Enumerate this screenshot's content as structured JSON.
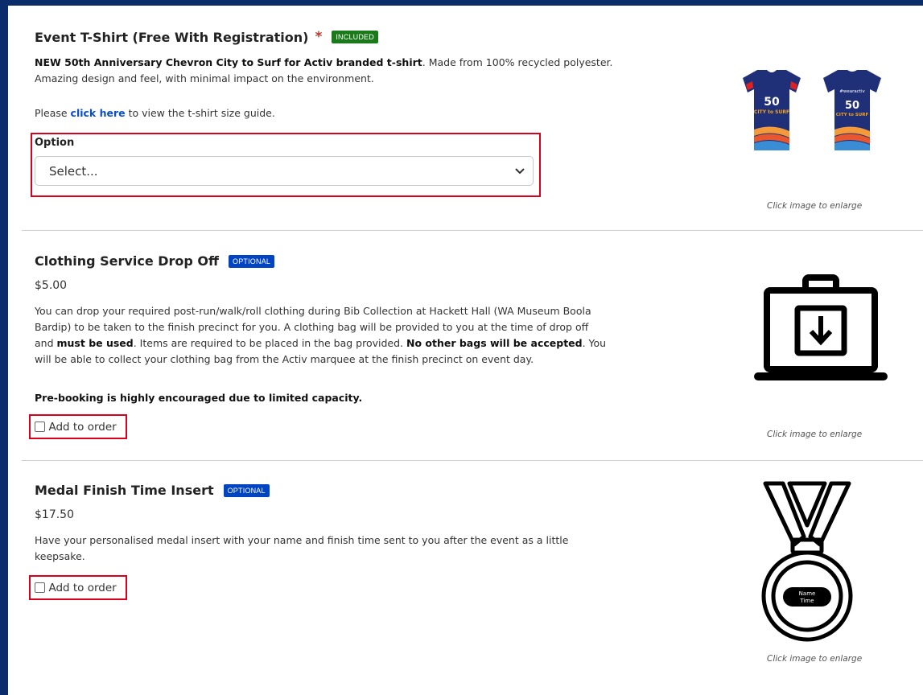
{
  "tshirt": {
    "title": "Event T-Shirt (Free With Registration)",
    "required_mark": "*",
    "badge": "INCLUDED",
    "desc_bold": "NEW 50th Anniversary Chevron City to Surf for Activ branded t-shirt",
    "desc_rest_1": ". Made from 100% recycled polyester.",
    "desc_line2": "Amazing design and feel, with minimal impact on the environment.",
    "guide_prefix": "Please ",
    "guide_link": "click here",
    "guide_suffix": " to view the t-shirt size guide.",
    "option_label": "Option",
    "select_value": "Select...",
    "caption": "Click image to enlarge",
    "shirt_text_front": "50",
    "shirt_text_back": "50",
    "shirt_hashtag": "#wearactiv",
    "shirt_city": "CITY to SURF"
  },
  "clothing": {
    "title": "Clothing Service Drop Off",
    "badge": "OPTIONAL",
    "price": "$5.00",
    "line1": "You can drop your required post-run/walk/roll clothing during Bib Collection at Hackett Hall (WA Museum Boola",
    "line2": "Bardip) to be taken to the finish precinct for you. A clothing bag will be provided to you at the time of drop off",
    "line3a": "and ",
    "line3b": "must be used",
    "line3c": ". Items are required to be placed in the bag provided. ",
    "line3d": "No other bags will be accepted",
    "line3e": ". You",
    "line4": "will be able to collect your clothing bag from the Activ marquee at the finish precinct on event day.",
    "note": "Pre-booking is highly encouraged due to limited capacity.",
    "add_label": "Add to order",
    "caption": "Click image to enlarge"
  },
  "medal": {
    "title": "Medal Finish Time Insert",
    "badge": "OPTIONAL",
    "price": "$17.50",
    "line1": "Have your personalised medal insert with your name and finish time sent to you after the event as a little",
    "line2": "keepsake.",
    "add_label": "Add to order",
    "caption": "Click image to enlarge",
    "insert_name": "Name",
    "insert_time": "Time"
  },
  "colors": {
    "frame": "#0c2d6b",
    "included_badge": "#1a7a1a",
    "optional_badge": "#0044c2",
    "highlight_box": "#d9001b",
    "link": "#0a4fc4"
  }
}
